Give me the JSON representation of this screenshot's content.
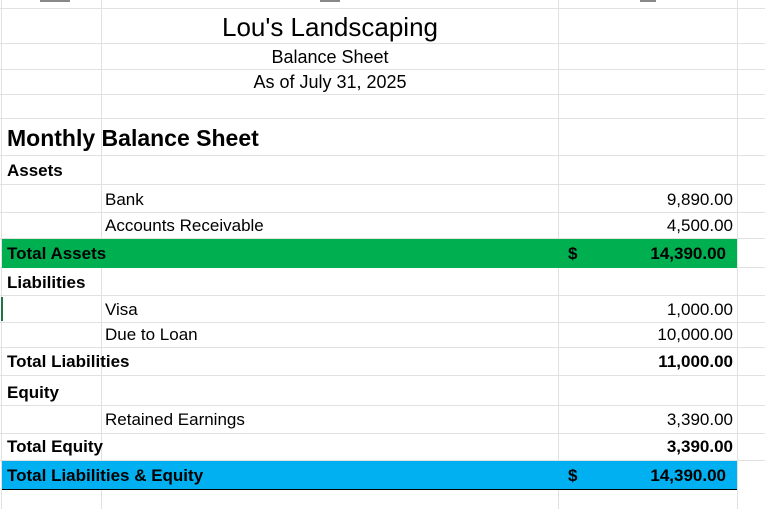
{
  "company": "Lou's Landscaping",
  "report_title": "Balance Sheet",
  "report_date": "As of July 31, 2025",
  "section_heading": "Monthly Balance Sheet",
  "assets": {
    "label": "Assets",
    "items": [
      {
        "name": "Bank",
        "amount": "9,890.00"
      },
      {
        "name": "Accounts Receivable",
        "amount": "4,500.00"
      }
    ],
    "total_label": "Total Assets",
    "currency": "$",
    "total": "14,390.00",
    "highlight": "#00b050"
  },
  "liabilities": {
    "label": "Liabilities",
    "items": [
      {
        "name": "Visa",
        "amount": "1,000.00"
      },
      {
        "name": "Due to Loan",
        "amount": "10,000.00"
      }
    ],
    "total_label": "Total Liabilities",
    "total": "11,000.00"
  },
  "equity": {
    "label": "Equity",
    "items": [
      {
        "name": "Retained Earnings",
        "amount": "3,390.00"
      }
    ],
    "total_label": "Total Equity",
    "total": "3,390.00"
  },
  "grand_total": {
    "label": "Total Liabilities & Equity",
    "currency": "$",
    "total": "14,390.00",
    "highlight": "#00b0f0"
  }
}
